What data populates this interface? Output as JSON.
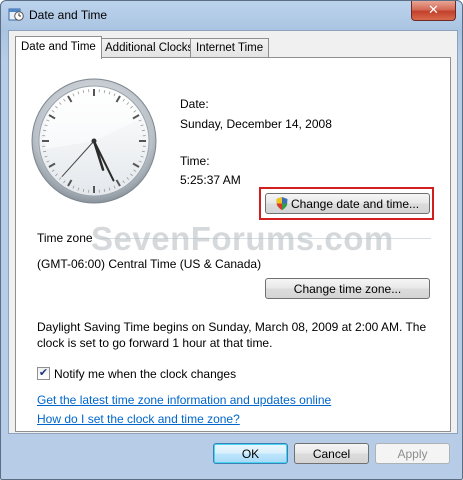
{
  "window": {
    "title": "Date and Time",
    "close_glyph": "✕"
  },
  "tabs": [
    {
      "label": "Date and Time",
      "active": true
    },
    {
      "label": "Additional Clocks",
      "active": false
    },
    {
      "label": "Internet Time",
      "active": false
    }
  ],
  "clock": {
    "hour": 5,
    "minute": 25,
    "second": 37
  },
  "date": {
    "label": "Date:",
    "value": "Sunday, December 14, 2008"
  },
  "time": {
    "label": "Time:",
    "value": "5:25:37 AM"
  },
  "change_datetime_button": {
    "label": "Change date and time..."
  },
  "timezone": {
    "heading": "Time zone",
    "value": "(GMT-06:00) Central Time (US & Canada)",
    "button": "Change time zone..."
  },
  "watermark": "SevenForums.com",
  "dst": {
    "text": "Daylight Saving Time begins on Sunday, March 08, 2009 at 2:00 AM. The clock is set to go forward 1 hour at that time."
  },
  "notify": {
    "label": "Notify me when the clock changes",
    "checked": true,
    "check_glyph": "✔"
  },
  "links": {
    "latest_info": "Get the latest time zone information and updates online",
    "how_to": "How do I set the clock and time zone?"
  },
  "footer": {
    "ok": "OK",
    "cancel": "Cancel",
    "apply": "Apply"
  }
}
